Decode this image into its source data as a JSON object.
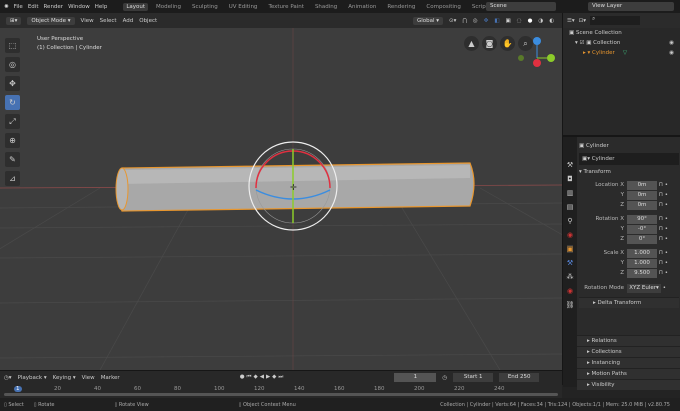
{
  "menu": [
    "File",
    "Edit",
    "Render",
    "Window",
    "Help"
  ],
  "workspaces": [
    "Layout",
    "Modeling",
    "Sculpting",
    "UV Editing",
    "Texture Paint",
    "Shading",
    "Animation",
    "Rendering",
    "Compositing",
    "Scripting"
  ],
  "scene": "Scene",
  "view_layer": "View Layer",
  "header": {
    "mode": "Object Mode",
    "view": "View",
    "select": "Select",
    "add": "Add",
    "object": "Object",
    "orientation": "Global"
  },
  "viewport": {
    "perspective": "User Perspective",
    "collection_label": "(1) Collection | Cylinder"
  },
  "outliner": {
    "scene_collection": "Scene Collection",
    "collection": "Collection",
    "object": "Cylinder"
  },
  "properties": {
    "object_name": "Cylinder",
    "data_name": "Cylinder",
    "transform": "Transform",
    "location": {
      "label": "Location X",
      "x": "0m",
      "y": "0m",
      "z": "0m"
    },
    "rotation": {
      "label": "Rotation X",
      "x": "90°",
      "y": "-0°",
      "z": "0°"
    },
    "scale": {
      "label": "Scale X",
      "x": "1.000",
      "y": "1.000",
      "z": "9.500"
    },
    "y": "Y",
    "z": "Z",
    "rotation_mode_label": "Rotation Mode",
    "rotation_mode": "XYZ Euler",
    "sections": [
      "Delta Transform",
      "Relations",
      "Collections",
      "Instancing",
      "Motion Paths",
      "Visibility"
    ]
  },
  "timeline": {
    "playback": "Playback",
    "keying": "Keying",
    "view": "View",
    "marker": "Marker",
    "current_frame": "1",
    "start_label": "Start",
    "start": "1",
    "end_label": "End",
    "end": "250",
    "ticks": [
      "1",
      "20",
      "40",
      "60",
      "80",
      "100",
      "120",
      "140",
      "160",
      "180",
      "200",
      "220",
      "240"
    ]
  },
  "status": {
    "select": "Select",
    "rotate": "Rotate",
    "rotate_view": "Rotate View",
    "context_menu": "Object Context Menu",
    "stats": "Collection | Cylinder | Verts:64 | Faces:34 | Tris:124 | Objects:1/1 | Mem: 25.0 MiB | v2.80.75"
  }
}
